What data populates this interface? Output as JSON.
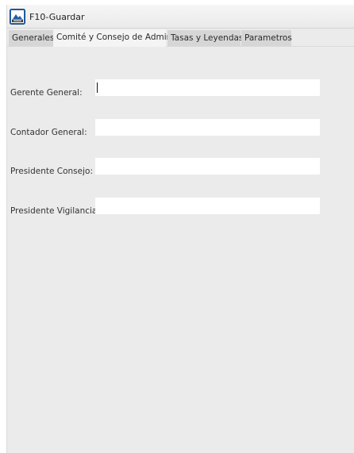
{
  "toolbar": {
    "save_label": "F10-Guardar",
    "save_icon": "save-printer-icon"
  },
  "tabs": [
    {
      "label": "Generales",
      "active": false
    },
    {
      "label": "Comité y Consejo de Admin.",
      "active": true
    },
    {
      "label": "Tasas y Leyendas",
      "active": false
    },
    {
      "label": "Parametros",
      "active": false
    }
  ],
  "form": {
    "gerente_general": {
      "label": "Gerente General:",
      "value": ""
    },
    "contador_general": {
      "label": "Contador General:",
      "value": ""
    },
    "presidente_consejo": {
      "label": "Presidente Consejo:",
      "value": ""
    },
    "presidente_vigilancia": {
      "label": "Presidente Vigilancia:",
      "value": ""
    }
  },
  "colors": {
    "background": "#ebebeb",
    "input_bg": "#ffffff",
    "tab_inactive": "#d6d6d6",
    "tab_active": "#f4f4f4",
    "icon_blue": "#1f5fa8"
  }
}
